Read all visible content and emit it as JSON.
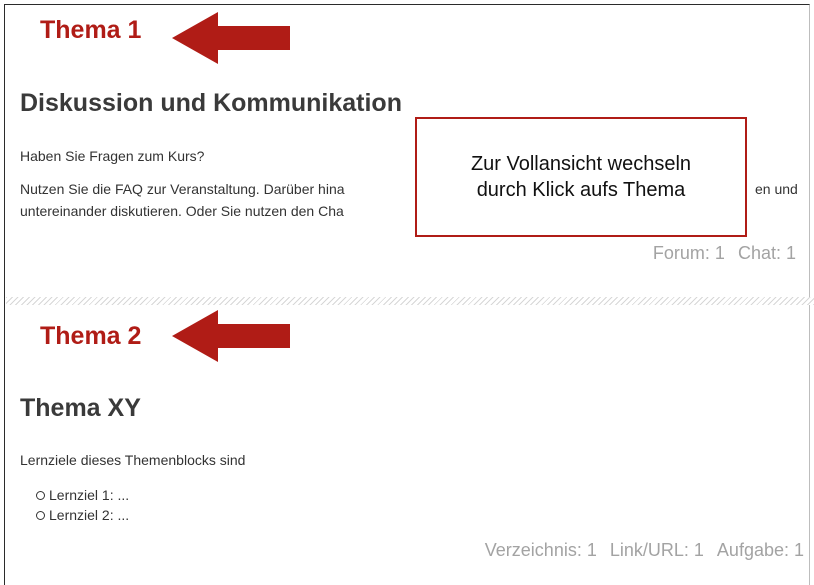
{
  "colors": {
    "annotation": "#b01c16",
    "muted_counts": "#a3a3a3",
    "title": "#3a3a3a"
  },
  "topic1": {
    "annotation_label": "Thema 1",
    "title": "Diskussion und Kommunikation",
    "text1": "Haben Sie Fragen zum Kurs?",
    "text2_line1": "Nutzen Sie die FAQ zur Veranstaltung. Darüber hina",
    "text2_line1_end": "en und",
    "text2_line2": "untereinander diskutieren. Oder Sie nutzen den Cha",
    "counts": [
      "Forum: 1",
      "Chat: 1"
    ]
  },
  "callout": {
    "line1": "Zur Vollansicht wechseln",
    "line2": "durch Klick aufs Thema"
  },
  "topic2": {
    "annotation_label": "Thema 2",
    "title": "Thema XY",
    "text1": "Lernziele dieses Themenblocks sind",
    "goals": [
      "Lernziel 1: ...",
      "Lernziel 2: ..."
    ],
    "counts": [
      "Verzeichnis: 1",
      "Link/URL: 1",
      "Aufgabe: 1"
    ]
  },
  "icons": {
    "annotation_arrow": "arrow-left-icon"
  }
}
